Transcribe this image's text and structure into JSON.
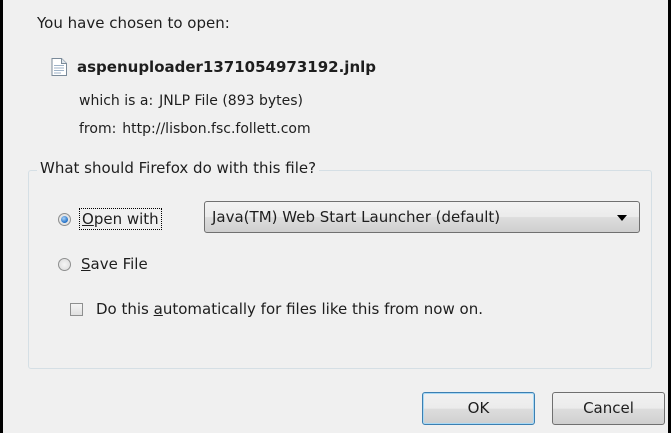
{
  "heading": "You have chosen to open:",
  "file": {
    "icon": "jnlp-file-icon",
    "name": "aspenuploader1371054973192.jnlp"
  },
  "details": {
    "type_label": "which is a:",
    "type_value": "JNLP File (893 bytes)",
    "from_label": "from:",
    "from_value": "http://lisbon.fsc.follett.com"
  },
  "action_group": {
    "legend": "What should Firefox do with this file?",
    "open_with": {
      "label_pre": "",
      "label_accel": "O",
      "label_post": "pen with",
      "checked": true
    },
    "application_select": {
      "value": "Java(TM) Web Start Launcher (default)"
    },
    "save_file": {
      "label_accel": "S",
      "label_post": "ave File",
      "checked": false
    },
    "auto": {
      "label_pre": "Do this ",
      "label_accel": "a",
      "label_post": "utomatically for files like this from now on.",
      "checked": false
    }
  },
  "buttons": {
    "ok": "OK",
    "cancel": "Cancel"
  },
  "colors": {
    "dialog_bg": "#f0f0f0",
    "window_border": "#000000",
    "radio_selected": "#1f6ec7",
    "default_button_border": "#3c7fb1"
  }
}
